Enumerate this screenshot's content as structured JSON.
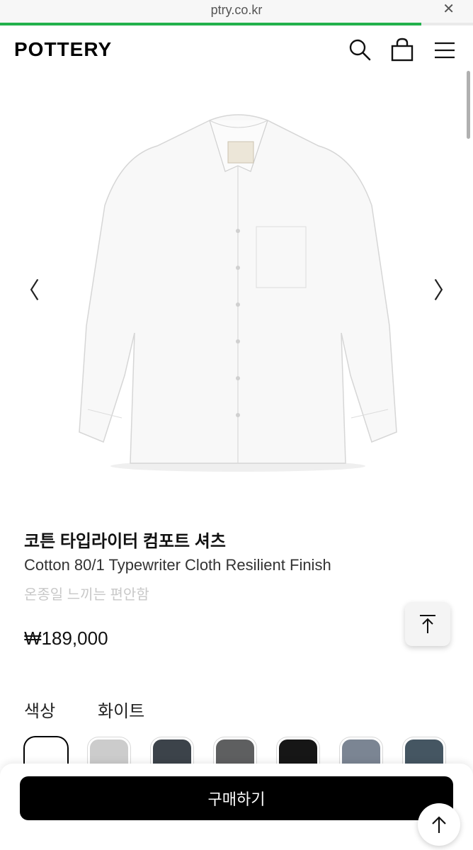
{
  "browser": {
    "url": "ptry.co.kr",
    "close_icon": "close-icon",
    "load_progress": 0.89
  },
  "header": {
    "logo": "POTTERY",
    "icons": [
      "search-icon",
      "shopping-bag-icon",
      "menu-icon"
    ]
  },
  "gallery": {
    "prev_glyph": "〈",
    "next_glyph": "〉"
  },
  "product": {
    "name_ko": "코튼 타입라이터 컴포트 셔츠",
    "name_en": "Cotton 80/1 Typewriter Cloth Resilient Finish",
    "description": "온종일 느끼는 편안함",
    "price": "₩189,000"
  },
  "color": {
    "label": "색상",
    "selected": "화이트",
    "swatches": [
      "#ffffff",
      "#cccccc",
      "#3c434a",
      "#5e5f60",
      "#161616",
      "#7b8593",
      "#455662"
    ]
  },
  "actions": {
    "buy_label": "구매하기",
    "scroll_top_icon": "arrow-up-icon"
  }
}
